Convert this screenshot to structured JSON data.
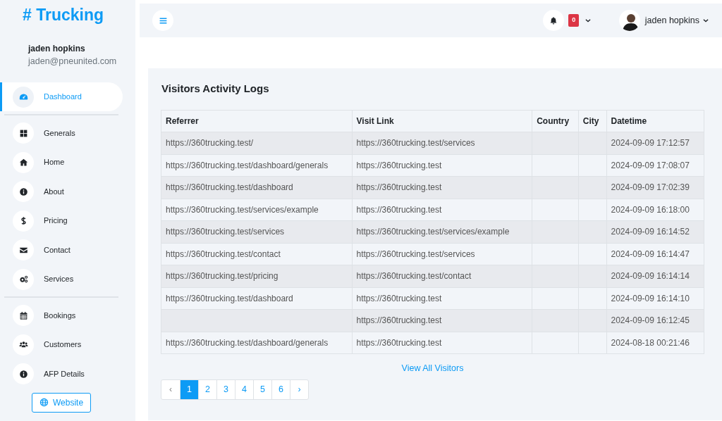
{
  "brand": {
    "hash": "#",
    "name": "Trucking"
  },
  "user": {
    "name": "jaden hopkins",
    "email": "jaden@pneunited.com"
  },
  "sidebar": {
    "groups": [
      {
        "items": [
          {
            "label": "Dashboard",
            "selected": true
          }
        ]
      },
      {
        "items": [
          {
            "label": "Generals",
            "selected": false
          },
          {
            "label": "Home",
            "selected": false
          },
          {
            "label": "About",
            "selected": false
          },
          {
            "label": "Pricing",
            "selected": false
          },
          {
            "label": "Contact",
            "selected": false
          },
          {
            "label": "Services",
            "selected": false
          }
        ]
      },
      {
        "items": [
          {
            "label": "Bookings",
            "selected": false
          },
          {
            "label": "Customers",
            "selected": false
          },
          {
            "label": "AFP Details",
            "selected": false
          }
        ]
      }
    ],
    "website_button": "Website"
  },
  "topbar": {
    "notification_count": "0",
    "user_name": "jaden hopkins"
  },
  "card": {
    "title": "Visitors Activity Logs",
    "table": {
      "columns": [
        "Referrer",
        "Visit Link",
        "Country",
        "City",
        "Datetime"
      ],
      "rows": [
        [
          "https://360trucking.test/",
          "https://360trucking.test/services",
          "",
          "",
          "2024-09-09 17:12:57"
        ],
        [
          "https://360trucking.test/dashboard/generals",
          "https://360trucking.test",
          "",
          "",
          "2024-09-09 17:08:07"
        ],
        [
          "https://360trucking.test/dashboard",
          "https://360trucking.test",
          "",
          "",
          "2024-09-09 17:02:39"
        ],
        [
          "https://360trucking.test/services/example",
          "https://360trucking.test",
          "",
          "",
          "2024-09-09 16:18:00"
        ],
        [
          "https://360trucking.test/services",
          "https://360trucking.test/services/example",
          "",
          "",
          "2024-09-09 16:14:52"
        ],
        [
          "https://360trucking.test/contact",
          "https://360trucking.test/services",
          "",
          "",
          "2024-09-09 16:14:47"
        ],
        [
          "https://360trucking.test/pricing",
          "https://360trucking.test/contact",
          "",
          "",
          "2024-09-09 16:14:14"
        ],
        [
          "https://360trucking.test/dashboard",
          "https://360trucking.test",
          "",
          "",
          "2024-09-09 16:14:10"
        ],
        [
          "",
          "https://360trucking.test",
          "",
          "",
          "2024-09-09 16:12:45"
        ],
        [
          "https://360trucking.test/dashboard/generals",
          "https://360trucking.test",
          "",
          "",
          "2024-08-18 00:21:46"
        ]
      ]
    },
    "view_all": "View All Visitors",
    "pagination": {
      "prev": "‹",
      "next": "›",
      "pages": [
        {
          "label": "1",
          "selected": true
        },
        {
          "label": "2",
          "selected": false
        },
        {
          "label": "3",
          "selected": false
        },
        {
          "label": "4",
          "selected": false
        },
        {
          "label": "5",
          "selected": false
        },
        {
          "label": "6",
          "selected": false
        }
      ]
    }
  }
}
